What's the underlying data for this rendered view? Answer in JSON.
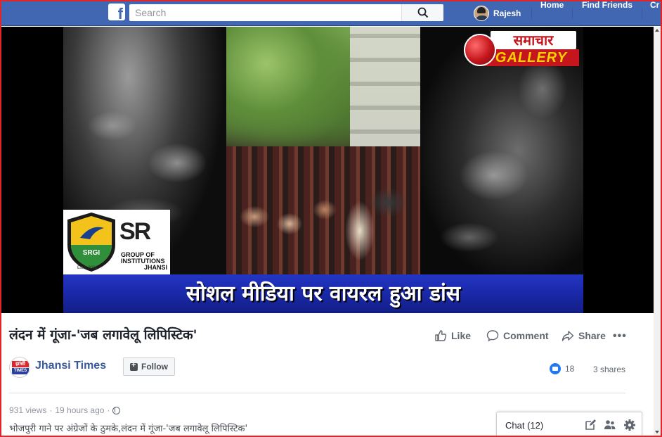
{
  "topbar": {
    "logo": "f",
    "search_placeholder": "Search",
    "user_name": "Rajesh",
    "nav": [
      "Home",
      "Find Friends",
      "Cr"
    ]
  },
  "video": {
    "banner_text": "सोशल मीडिया पर वायरल हुआ डांस",
    "brand_top": "समाचार",
    "brand_bottom": "GALLERY",
    "sponsor_logo": "SRGI",
    "sponsor_estd": "Estd. 2002",
    "sponsor_mark": "SR",
    "sponsor_line1": "GROUP OF",
    "sponsor_line2": "INSTITUTIONS",
    "sponsor_line3": "JHANSI"
  },
  "post": {
    "title": "लंदन में गूंजा-'जब लगावेलू लिपिस्टिक'",
    "actions": {
      "like": "Like",
      "comment": "Comment",
      "share": "Share"
    },
    "more": "•••",
    "page_name": "Jhansi Times",
    "page_logo_top": "झांसी",
    "page_logo_bottom": "TIMES",
    "follow_label": "Follow",
    "reaction_count": "18",
    "shares": "3 shares",
    "views": "931 views",
    "time": "19 hours ago",
    "separator": "·",
    "description": "भोजपुरी गाने पर अंग्रेजों के ठुमके,लंदन में गूंजा-'जब लगावेलू लिपिस्टिक'"
  },
  "chat": {
    "label": "Chat (12)"
  },
  "colors": {
    "fb_blue": "#4267b2",
    "link_blue": "#385898",
    "banner_blue": "#1a28a8",
    "brand_red": "#c4161c",
    "frame_red": "#e0262b"
  }
}
